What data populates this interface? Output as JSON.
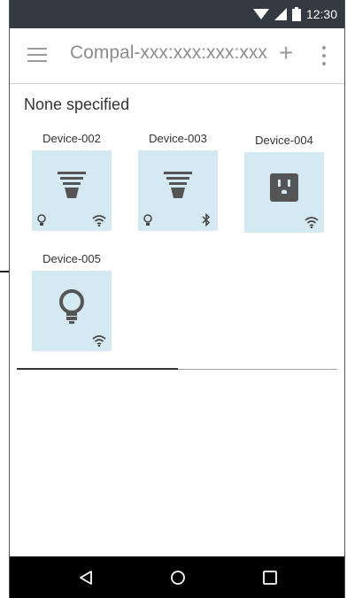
{
  "status_bar": {
    "time": "12:30",
    "background": "#333a41"
  },
  "app_bar": {
    "title": "Compal-xxx:xxx:xxx:xxx",
    "add_label": "+"
  },
  "section": {
    "title": "None specified"
  },
  "devices": [
    {
      "name": "Device-002",
      "icon": "ceiling-lamp-icon",
      "badge_left": "bulb-icon",
      "badge_right": "wifi-icon"
    },
    {
      "name": "Device-003",
      "icon": "ceiling-lamp-icon",
      "badge_left": "bulb-icon",
      "badge_right": "bluetooth-icon"
    },
    {
      "name": "Device-004",
      "icon": "power-outlet-icon",
      "badge_right": "wifi-icon"
    },
    {
      "name": "Device-005",
      "icon": "light-bulb-icon",
      "badge_right": "wifi-icon"
    }
  ],
  "colors": {
    "tile": "#d4e9f1",
    "icon": "#555555",
    "navbar": "#000000"
  },
  "navigation": {
    "back": "back-icon",
    "home": "home-icon",
    "recents": "recents-icon"
  }
}
